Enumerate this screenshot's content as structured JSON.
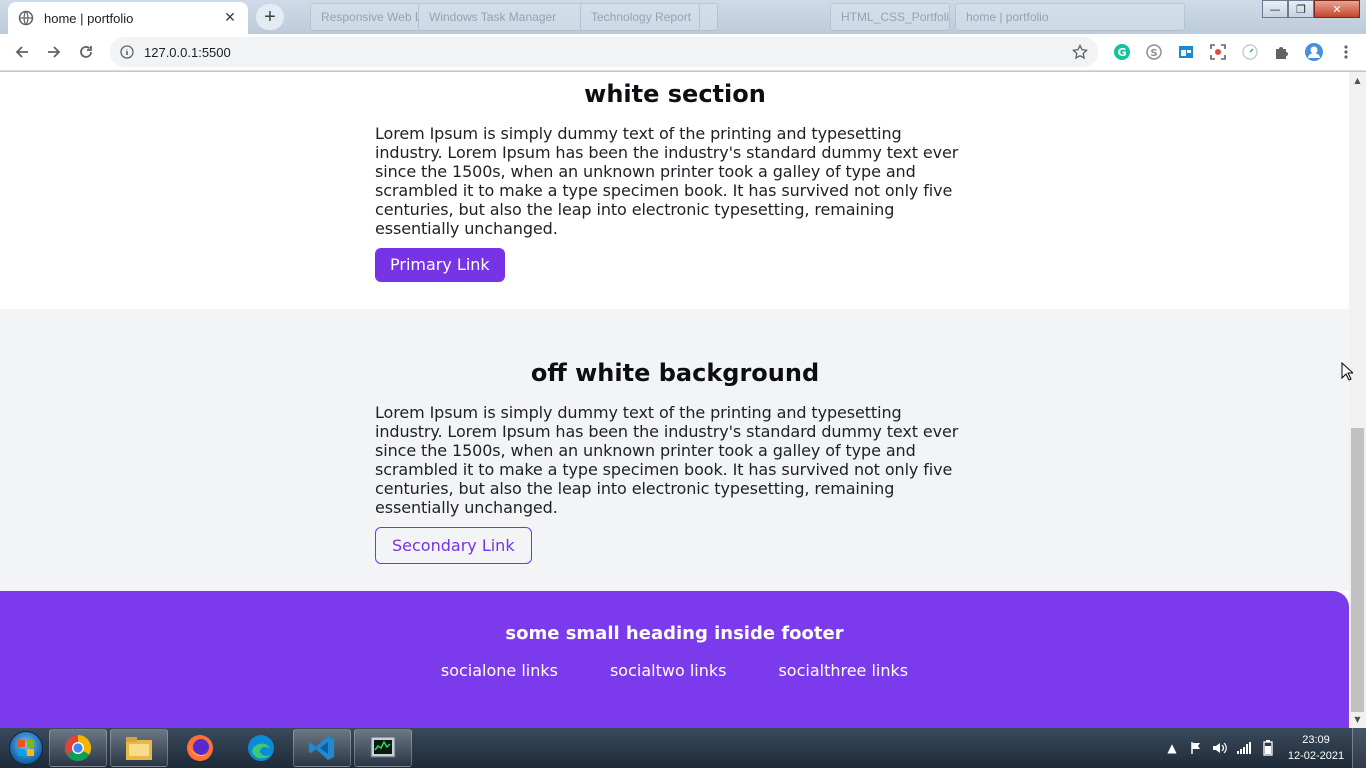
{
  "browser": {
    "active_tab": {
      "title": "home | portfolio",
      "close_glyph": "✕"
    },
    "new_tab_glyph": "+",
    "background_tabs": [
      "Responsive Web Design",
      "Windows Task Manager",
      "Technology Report",
      "HTML_CSS_Portfolio",
      "home | portfolio"
    ],
    "window_controls": {
      "minimize": "—",
      "maximize": "❐",
      "close": "✕"
    },
    "address": {
      "url": "127.0.0.1:5500"
    },
    "extensions": [
      "grammarly-icon",
      "skype-icon",
      "window-icon",
      "screenshot-icon",
      "timer-icon",
      "puzzle-icon",
      "profile-icon",
      "menu-icon"
    ]
  },
  "page": {
    "white_section": {
      "heading": "white section",
      "paragraph": "Lorem Ipsum is simply dummy text of the printing and typesetting industry. Lorem Ipsum has been the industry's standard dummy text ever since the 1500s, when an unknown printer took a galley of type and scrambled it to make a type specimen book. It has survived not only five centuries, but also the leap into electronic typesetting, remaining essentially unchanged.",
      "button_label": "Primary Link"
    },
    "off_white_section": {
      "heading": "off white background",
      "paragraph": "Lorem Ipsum is simply dummy text of the printing and typesetting industry. Lorem Ipsum has been the industry's standard dummy text ever since the 1500s, when an unknown printer took a galley of type and scrambled it to make a type specimen book. It has survived not only five centuries, but also the leap into electronic typesetting, remaining essentially unchanged.",
      "button_label": "Secondary Link"
    },
    "footer": {
      "heading": "some small heading inside footer",
      "links": [
        "socialone links",
        "socialtwo links",
        "socialthree links"
      ]
    }
  },
  "taskbar": {
    "apps": [
      "chrome-icon",
      "file-explorer-icon",
      "firefox-icon",
      "edge-icon",
      "vscode-icon",
      "task-manager-icon"
    ],
    "clock": {
      "time": "23:09",
      "date": "12-02-2021"
    }
  },
  "colors": {
    "accent": "#7c3aed",
    "button": "#7733e6",
    "off_white": "#f3f4f6"
  }
}
